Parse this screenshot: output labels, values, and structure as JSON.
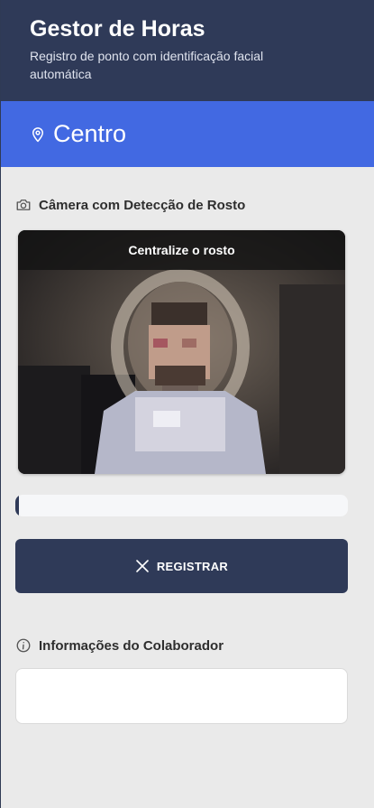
{
  "header": {
    "title": "Gestor de Horas",
    "subtitle": "Registro de ponto com identificação facial automática"
  },
  "location": {
    "icon": "map-pin-icon",
    "name": "Centro"
  },
  "camera_section": {
    "icon": "camera-icon",
    "title": "Câmera com Detecção de Rosto",
    "banner_text": "Centralize o rosto"
  },
  "progress": {
    "fraction": 0.01
  },
  "register_button": {
    "icon": "close-icon",
    "label": "REGISTRAR"
  },
  "info_section": {
    "icon": "info-icon",
    "title": "Informações do Colaborador"
  },
  "colors": {
    "header_bg": "#2f3a58",
    "accent_blue": "#4269e2",
    "page_bg": "#eaeaea"
  }
}
